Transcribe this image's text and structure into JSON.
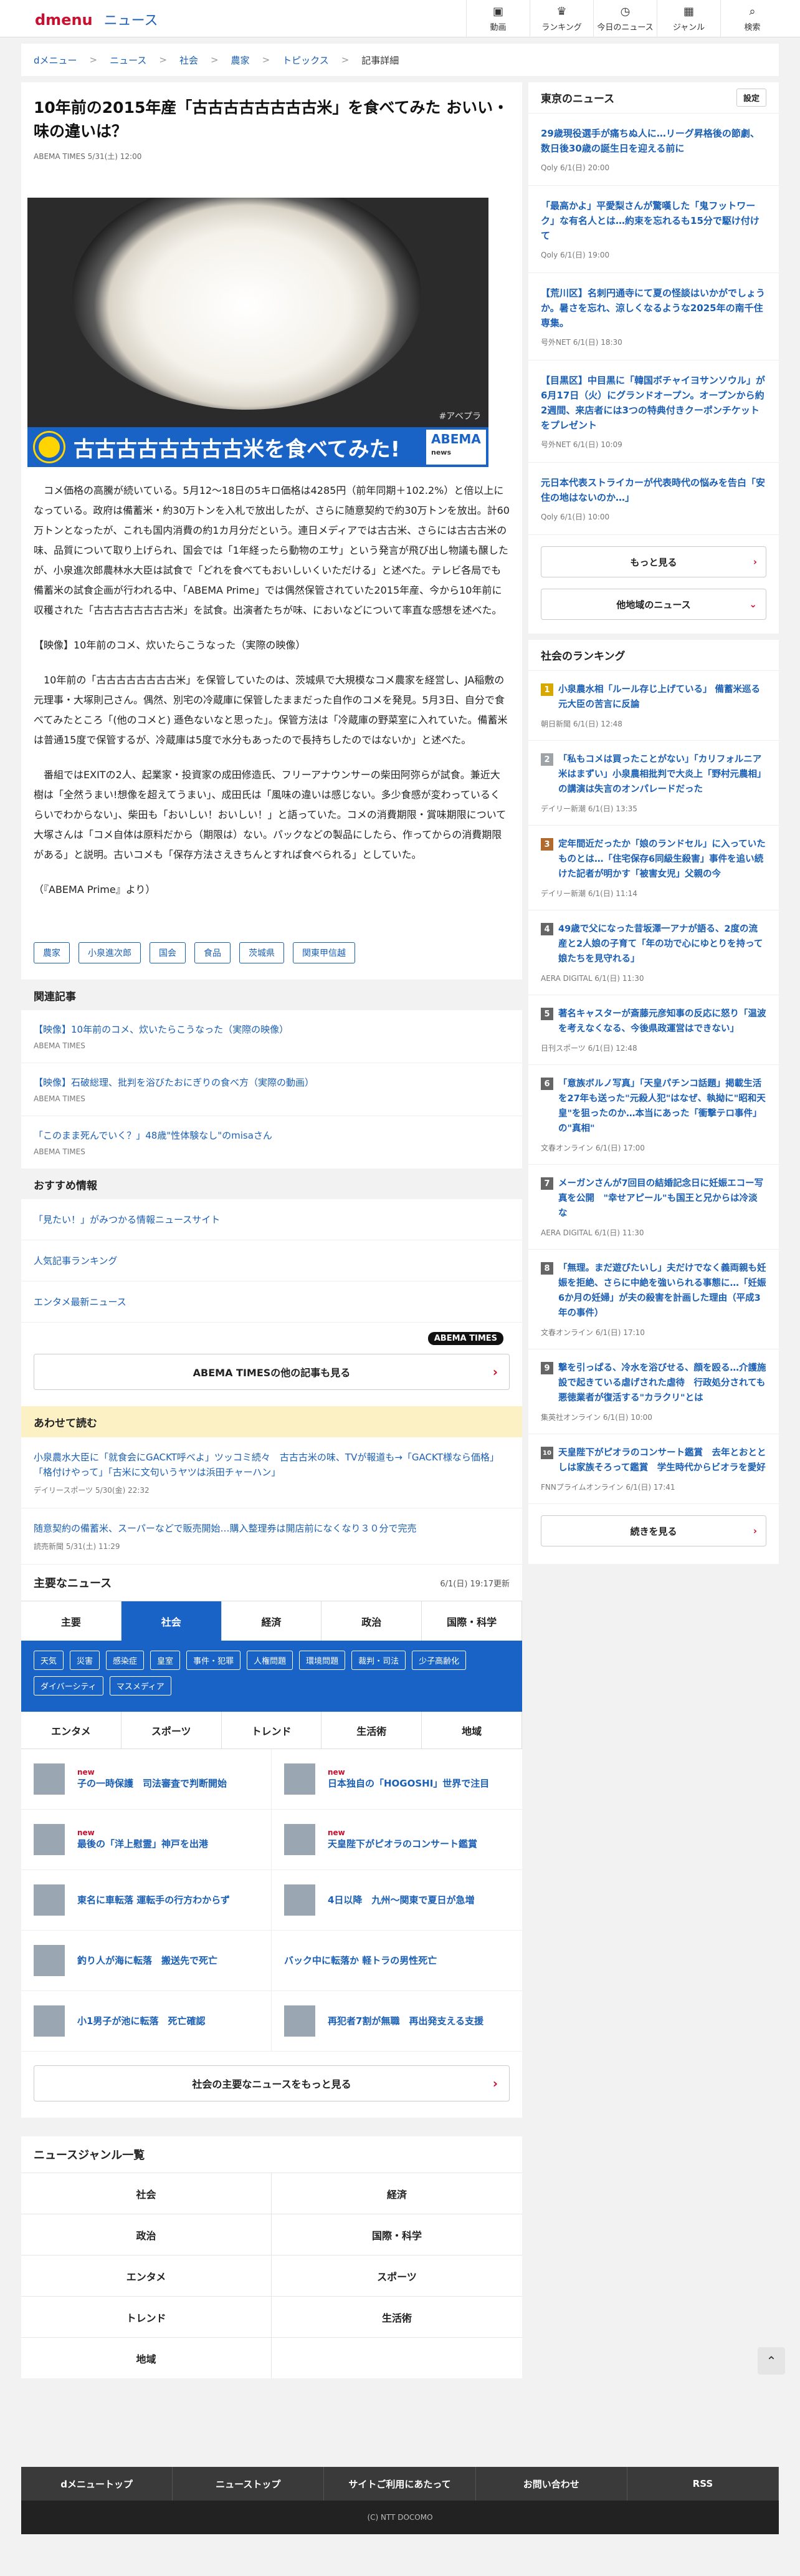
{
  "header": {
    "brand": "dmenu",
    "service": "ニュース",
    "nav": [
      {
        "icon": "▣",
        "label": "動画"
      },
      {
        "icon": "♛",
        "label": "ランキング"
      },
      {
        "icon": "◷",
        "label": "今日のニュース"
      },
      {
        "icon": "▦",
        "label": "ジャンル"
      },
      {
        "icon": "⌕",
        "label": "検索"
      }
    ]
  },
  "breadcrumb": [
    "dメニュー",
    "ニュース",
    "社会",
    "農家",
    "トピックス"
  ],
  "breadcrumb_current": "記事詳細",
  "article": {
    "title": "10年前の2015年産「古古古古古古古古米」を食べてみた おいい・味の違いは？",
    "meta": "ABEMA TIMES 5/31(土) 12:00",
    "caption": "古古古古古古古古米を食べてみた!",
    "caption_logo": "ABEMA",
    "caption_logo_sub": "news",
    "watermark": "#アベプラ",
    "paras": [
      "コメ価格の高騰が続いている。5月12〜18日の5キロ価格は4285円（前年同期＋102.2%）と倍以上になっている。政府は備蓄米・約30万トンを入札で放出したが、さらに随意契約で約30万トンを放出。計60万トンとなったが、これも国内消費の約1カ月分だという。連日メディアでは古古米、さらには古古古米の味、品質について取り上げられ、国会では「1年経ったら動物のエサ」という発言が飛び出し物議も醸したが、小泉進次郎農林水大臣は試食で「どれを食べてもおいしいくいただける」と述べた。テレビ各局でも備蓄米の試食企画が行われる中、「ABEMA Prime」では偶然保管されていた2015年産、今から10年前に収穫された「古古古古古古古古米」を試食。出演者たちが味、においなどについて率直な感想を述べた。",
      "【映像】10年前のコメ、炊いたらこうなった（実際の映像）",
      "10年前の「古古古古古古古古米」を保管していたのは、茨城県で大規模なコメ農家を経営し、JA稲敷の元理事・大塚則己さん。偶然、別宅の冷蔵庫に保管したままだった自作のコメを発見。5月3日、自分で食べてみたところ「(他のコメと) 遜色ないなと思った」。保管方法は「冷蔵庫の野菜室に入れていた。備蓄米は普通15度で保管するが、冷蔵庫は5度で水分もあったので長持ちしたのではないか」と述べた。",
      "番組ではEXITの2人、起業家・投資家の成田修造氏、フリーアナウンサーの柴田阿弥らが試食。兼近大樹は「全然うまい!想像を超えてうまい」、成田氏は「風味の違いは感じない。多少食感が変わっているくらいでわからない」、柴田も「おいしい！おいしい！」と語っていた。コメの消費期限・賞味期限について大塚さんは「コメ自体は原料だから（期限は）ない。パックなどの製品にしたら、作ってからの消費期限がある」と説明。古いコメも「保存方法さえきちんとすれば食べられる」としていた。",
      "（『ABEMA Prime』より）"
    ],
    "tags": [
      "農家",
      "小泉進次郎",
      "国会",
      "食品",
      "茨城県",
      "関東甲信越"
    ]
  },
  "related": {
    "heading": "関連記事",
    "items": [
      {
        "title": "【映像】10年前のコメ、炊いたらこうなった（実際の映像）",
        "src": "ABEMA TIMES"
      },
      {
        "title": "【映像】石破総理、批判を浴びたおにぎりの食べ方（実際の動画）",
        "src": "ABEMA TIMES"
      },
      {
        "title": "「このまま死んでいく？」48歳\"性体験なし\"のmisaさん",
        "src": "ABEMA TIMES"
      }
    ]
  },
  "recommend": {
    "heading": "おすすめ情報",
    "items": [
      "「見たい！」がみつかる情報ニュースサイト",
      "人気記事ランキング",
      "エンタメ最新ニュース"
    ],
    "badge": "ABEMA TIMES",
    "more": "ABEMA TIMESの他の記事も見る"
  },
  "also": {
    "heading": "あわせて読む",
    "items": [
      {
        "title": "小泉農水大臣に「就食会にGACKT呼べよ」ツッコミ続々　古古古米の味、TVが報道も→「GACKT様なら価格」「格付けやって」「古米に文句いうヤツは浜田チャーハン」",
        "src": "デイリースポーツ 5/30(金) 22:32"
      },
      {
        "title": "随意契約の備蓄米、スーパーなどで販売開始…購入整理券は開店前になくなり３０分で完売",
        "src": "読売新聞 5/31(土) 11:29"
      }
    ]
  },
  "main_news": {
    "heading": "主要なニュース",
    "updated": "6/1(日) 19:17更新",
    "tabs": [
      "主要",
      "社会",
      "経済",
      "政治",
      "国際・科学"
    ],
    "chips": [
      "天気",
      "災害",
      "感染症",
      "皇室",
      "事件・犯罪",
      "人権問題",
      "環境問題",
      "裁判・司法",
      "少子高齢化",
      "ダイバーシティ",
      "マスメディア"
    ],
    "tabs2": [
      "エンタメ",
      "スポーツ",
      "トレンド",
      "生活術",
      "地域"
    ],
    "new_label": "new",
    "items": [
      {
        "title": "子の一時保護　司法審査で判断開始",
        "new": true
      },
      {
        "title": "日本独自の「HOGOSHI」世界で注目",
        "new": true
      },
      {
        "title": "最後の「洋上慰霊」神戸を出港",
        "new": true
      },
      {
        "title": "天皇陛下がピオラのコンサート鑑賞",
        "new": true
      },
      {
        "title": "東名に車転落 運転手の行方わからず",
        "new": false
      },
      {
        "title": "4日以降　九州〜関東で夏日が急増",
        "new": false
      },
      {
        "title": "釣り人が海に転落　搬送先で死亡",
        "new": false
      },
      {
        "title": "バック中に転落か 軽トラの男性死亡",
        "new": false
      },
      {
        "title": "小1男子が池に転落　死亡確認",
        "new": false
      },
      {
        "title": "再犯者7割が無職　再出発支える支援",
        "new": false
      }
    ],
    "more": "社会の主要なニュースをもっと見る"
  },
  "genres": {
    "heading": "ニュースジャンル一覧",
    "items": [
      "社会",
      "経済",
      "政治",
      "国際・科学",
      "エンタメ",
      "スポーツ",
      "トレンド",
      "生活術",
      "地域"
    ]
  },
  "tokyo": {
    "heading": "東京のニュース",
    "settings": "設定",
    "items": [
      {
        "title": "29歳現役選手が痛ちぬ人に…リーグ昇格後の節劇、数日後30歳の誕生日を迎える前に",
        "src": "Qoly 6/1(日) 20:00"
      },
      {
        "title": "「最高かよ」平愛梨さんが驚嘆した「鬼フットワーク」な有名人とは…約束を忘れるも15分で駆け付けて",
        "src": "Qoly 6/1(日) 19:00"
      },
      {
        "title": "【荒川区】名刺円通寺にて夏の怪談はいかがでしょうか。暑さを忘れ、涼しくなるような2025年の南千住専集。",
        "src": "号外NET 6/1(日) 18:30"
      },
      {
        "title": "【目黒区】中目黒に「韓国ボチャイヨサンソウル」が6月17日（火）にグランドオープン。オープンから約2週間、来店者には3つの特典付きクーポンチケットをプレゼント",
        "src": "号外NET 6/1(日) 10:09"
      },
      {
        "title": "元日本代表ストライカーが代表時代の悩みを告白「安住の地はないのか…」",
        "src": "Qoly 6/1(日) 10:00"
      }
    ],
    "more": "もっと見る",
    "other": "他地域のニュース"
  },
  "ranking": {
    "heading": "社会のランキング",
    "items": [
      {
        "title": "小泉農水相「ルール存じ上げている」 備蓄米巡る元大臣の苦言に反論",
        "src": "朝日新聞 6/1(日) 12:48"
      },
      {
        "title": "「私もコメは買ったことがない」「カリフォルニア米はまずい」小泉農相批判で大炎上「野村元農相」の講演は失言のオンパレードだった",
        "src": "デイリー新潮 6/1(日) 13:35"
      },
      {
        "title": "定年間近だったか「娘のランドセル」に入っていたものとは…「住宅保存6同級生殺害」事件を追い続けた記者が明かす「被害女児」父親の今",
        "src": "デイリー新潮 6/1(日) 11:14"
      },
      {
        "title": "49歳で父になった昔坂澤一アナが語る、2度の流産と2人娘の子育て「年の功で心にゆとりを持って娘たちを見守れる」",
        "src": "AERA DIGITAL 6/1(日) 11:30"
      },
      {
        "title": "著名キャスターが斎藤元彦知事の反応に怒り「温波を考えなくなる、今後県政運営はできない」",
        "src": "日刊スポーツ 6/1(日) 12:48"
      },
      {
        "title": "「意族ボルノ写真」「天皇パチンコ話題」掲載生活を27年も送った\"元殺人犯\"はなぜ、執拗に\"昭和天皇\"を狙ったのか…本当にあった「衝撃テロ事件」の\"真相\"",
        "src": "文春オンライン 6/1(日) 17:00"
      },
      {
        "title": "メーガンさんが7回目の結婚記念日に妊娠エコー写真を公開　\"幸せアピール\"も国王と兄からは冷淡な",
        "src": "AERA DIGITAL 6/1(日) 11:30"
      },
      {
        "title": "「無理。まだ遊びたいし」夫だけでなく義両親も妊娠を拒絶、さらに中絶を強いられる事態に…「妊娠6か月の妊婦」が夫の殺害を計画した理由（平成3年の事件）",
        "src": "文春オンライン 6/1(日) 17:10"
      },
      {
        "title": "撃を引っぱる、冷水を浴びせる、顔を殴る…介護施設で起きている虐げされた虐待　行政処分されても悪徳業者が復活する\"カラクリ\"とは",
        "src": "集英社オンライン 6/1(日) 10:00"
      },
      {
        "title": "天皇陛下がピオラのコンサート鑑賞　去年とおととしは家族そろって鑑賞　学生時代からビオラを愛好",
        "src": "FNNプライムオンライン 6/1(日) 17:41"
      }
    ],
    "more": "続きを見る"
  },
  "footer": {
    "nav": [
      "dメニュートップ",
      "ニューストップ",
      "サイトご利用にあたって",
      "お問い合わせ",
      "RSS"
    ],
    "copyright": "(C) NTT DOCOMO"
  }
}
